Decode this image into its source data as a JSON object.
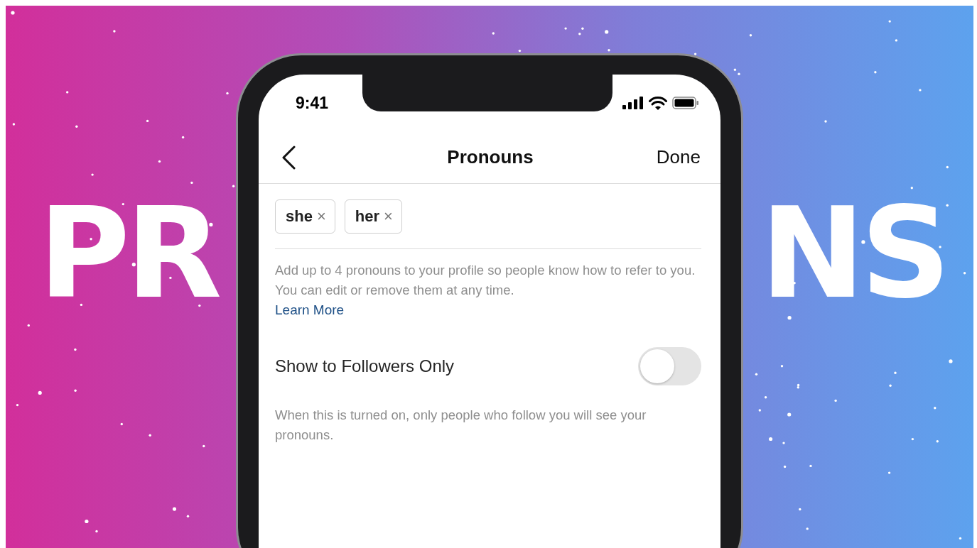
{
  "background_title": {
    "left": "PR",
    "right": "NS"
  },
  "status_bar": {
    "time": "9:41"
  },
  "nav": {
    "title": "Pronouns",
    "done": "Done"
  },
  "pronoun_chips": [
    {
      "label": "she",
      "remove": "×"
    },
    {
      "label": "her",
      "remove": "×"
    }
  ],
  "help_text": "Add up to 4 pronouns to your profile so people know how to refer to you. You can edit or remove them at any time.",
  "learn_more": "Learn More",
  "setting": {
    "label": "Show to Followers Only",
    "on": false
  },
  "setting_note": "When this is turned on, only people who follow you will see your pronouns."
}
